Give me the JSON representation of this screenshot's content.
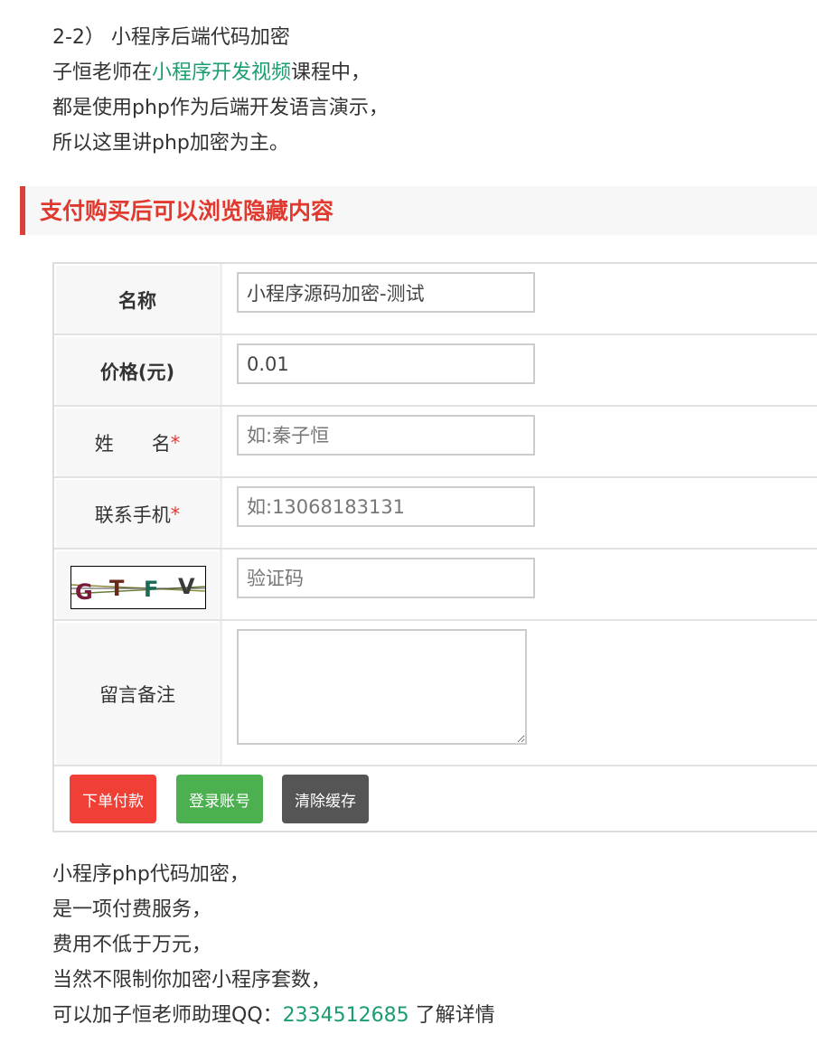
{
  "intro": {
    "line1": "2-2） 小程序后端代码加密",
    "line2_pre": "子恒老师在",
    "line2_link": "小程序开发视频",
    "line2_post": "课程中，",
    "line3": "都是使用php作为后端开发语言演示，",
    "line4": "所以这里讲php加密为主。"
  },
  "section": {
    "title": "支付购买后可以浏览隐藏内容"
  },
  "form": {
    "name_label": "名称",
    "name_value": "小程序源码加密-测试",
    "price_label": "价格(元)",
    "price_value": "0.01",
    "fullname_label": "姓　　名",
    "fullname_placeholder": "如:秦子恒",
    "phone_label": "联系手机",
    "phone_placeholder": "如:13068183131",
    "required_mark": "*",
    "captcha_text": [
      "G",
      "T",
      "F",
      "V"
    ],
    "captcha_placeholder": "验证码",
    "note_label": "留言备注",
    "note_value": ""
  },
  "buttons": {
    "pay": "下单付款",
    "login": "登录账号",
    "clear": "清除缓存"
  },
  "outro": {
    "line1": "小程序php代码加密，",
    "line2": "是一项付费服务，",
    "line3": "费用不低于万元，",
    "line4": "当然不限制你加密小程序套数，",
    "line5_pre": "可以加子恒老师助理QQ：",
    "line5_qq": "2334512685",
    "line5_post": " 了解详情"
  },
  "colors": {
    "accent_red": "#e2392f",
    "link_green": "#1a9e6e",
    "btn_red": "#f03f35",
    "btn_green": "#4caf50",
    "btn_dark": "#555555"
  }
}
